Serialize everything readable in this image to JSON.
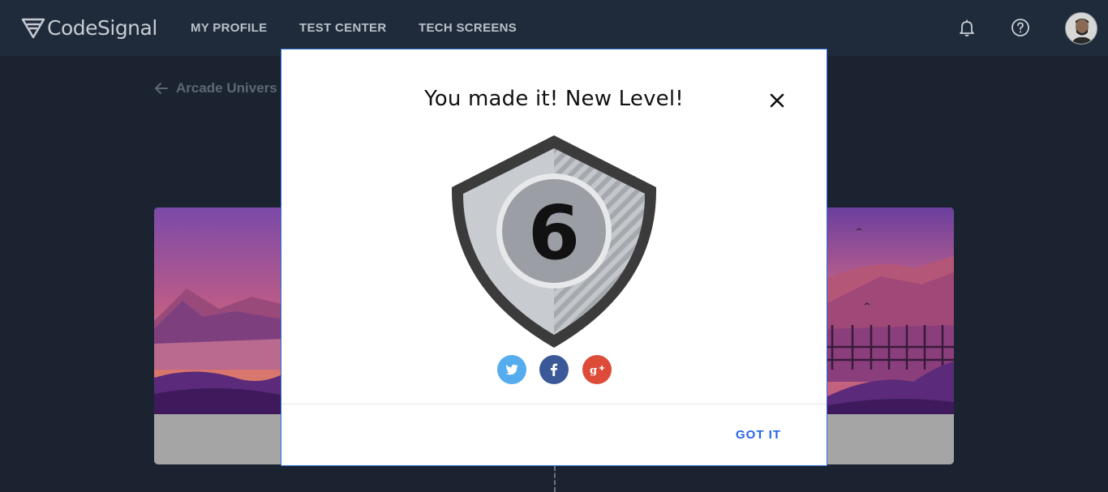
{
  "app": {
    "brand": "CodeSignal"
  },
  "nav": {
    "links": [
      "MY PROFILE",
      "TEST CENTER",
      "TECH SCREENS"
    ],
    "icons": [
      "bell-icon",
      "help-icon"
    ]
  },
  "page": {
    "back_label": "Arcade Univers"
  },
  "modal": {
    "title": "You made it! New Level!",
    "level": "6",
    "share": [
      "twitter",
      "facebook",
      "google-plus"
    ],
    "confirm_label": "GOT IT",
    "colors": {
      "accent": "#2563eb",
      "twitter": "#55acee",
      "facebook": "#3b5998",
      "google": "#dd4b39"
    }
  }
}
